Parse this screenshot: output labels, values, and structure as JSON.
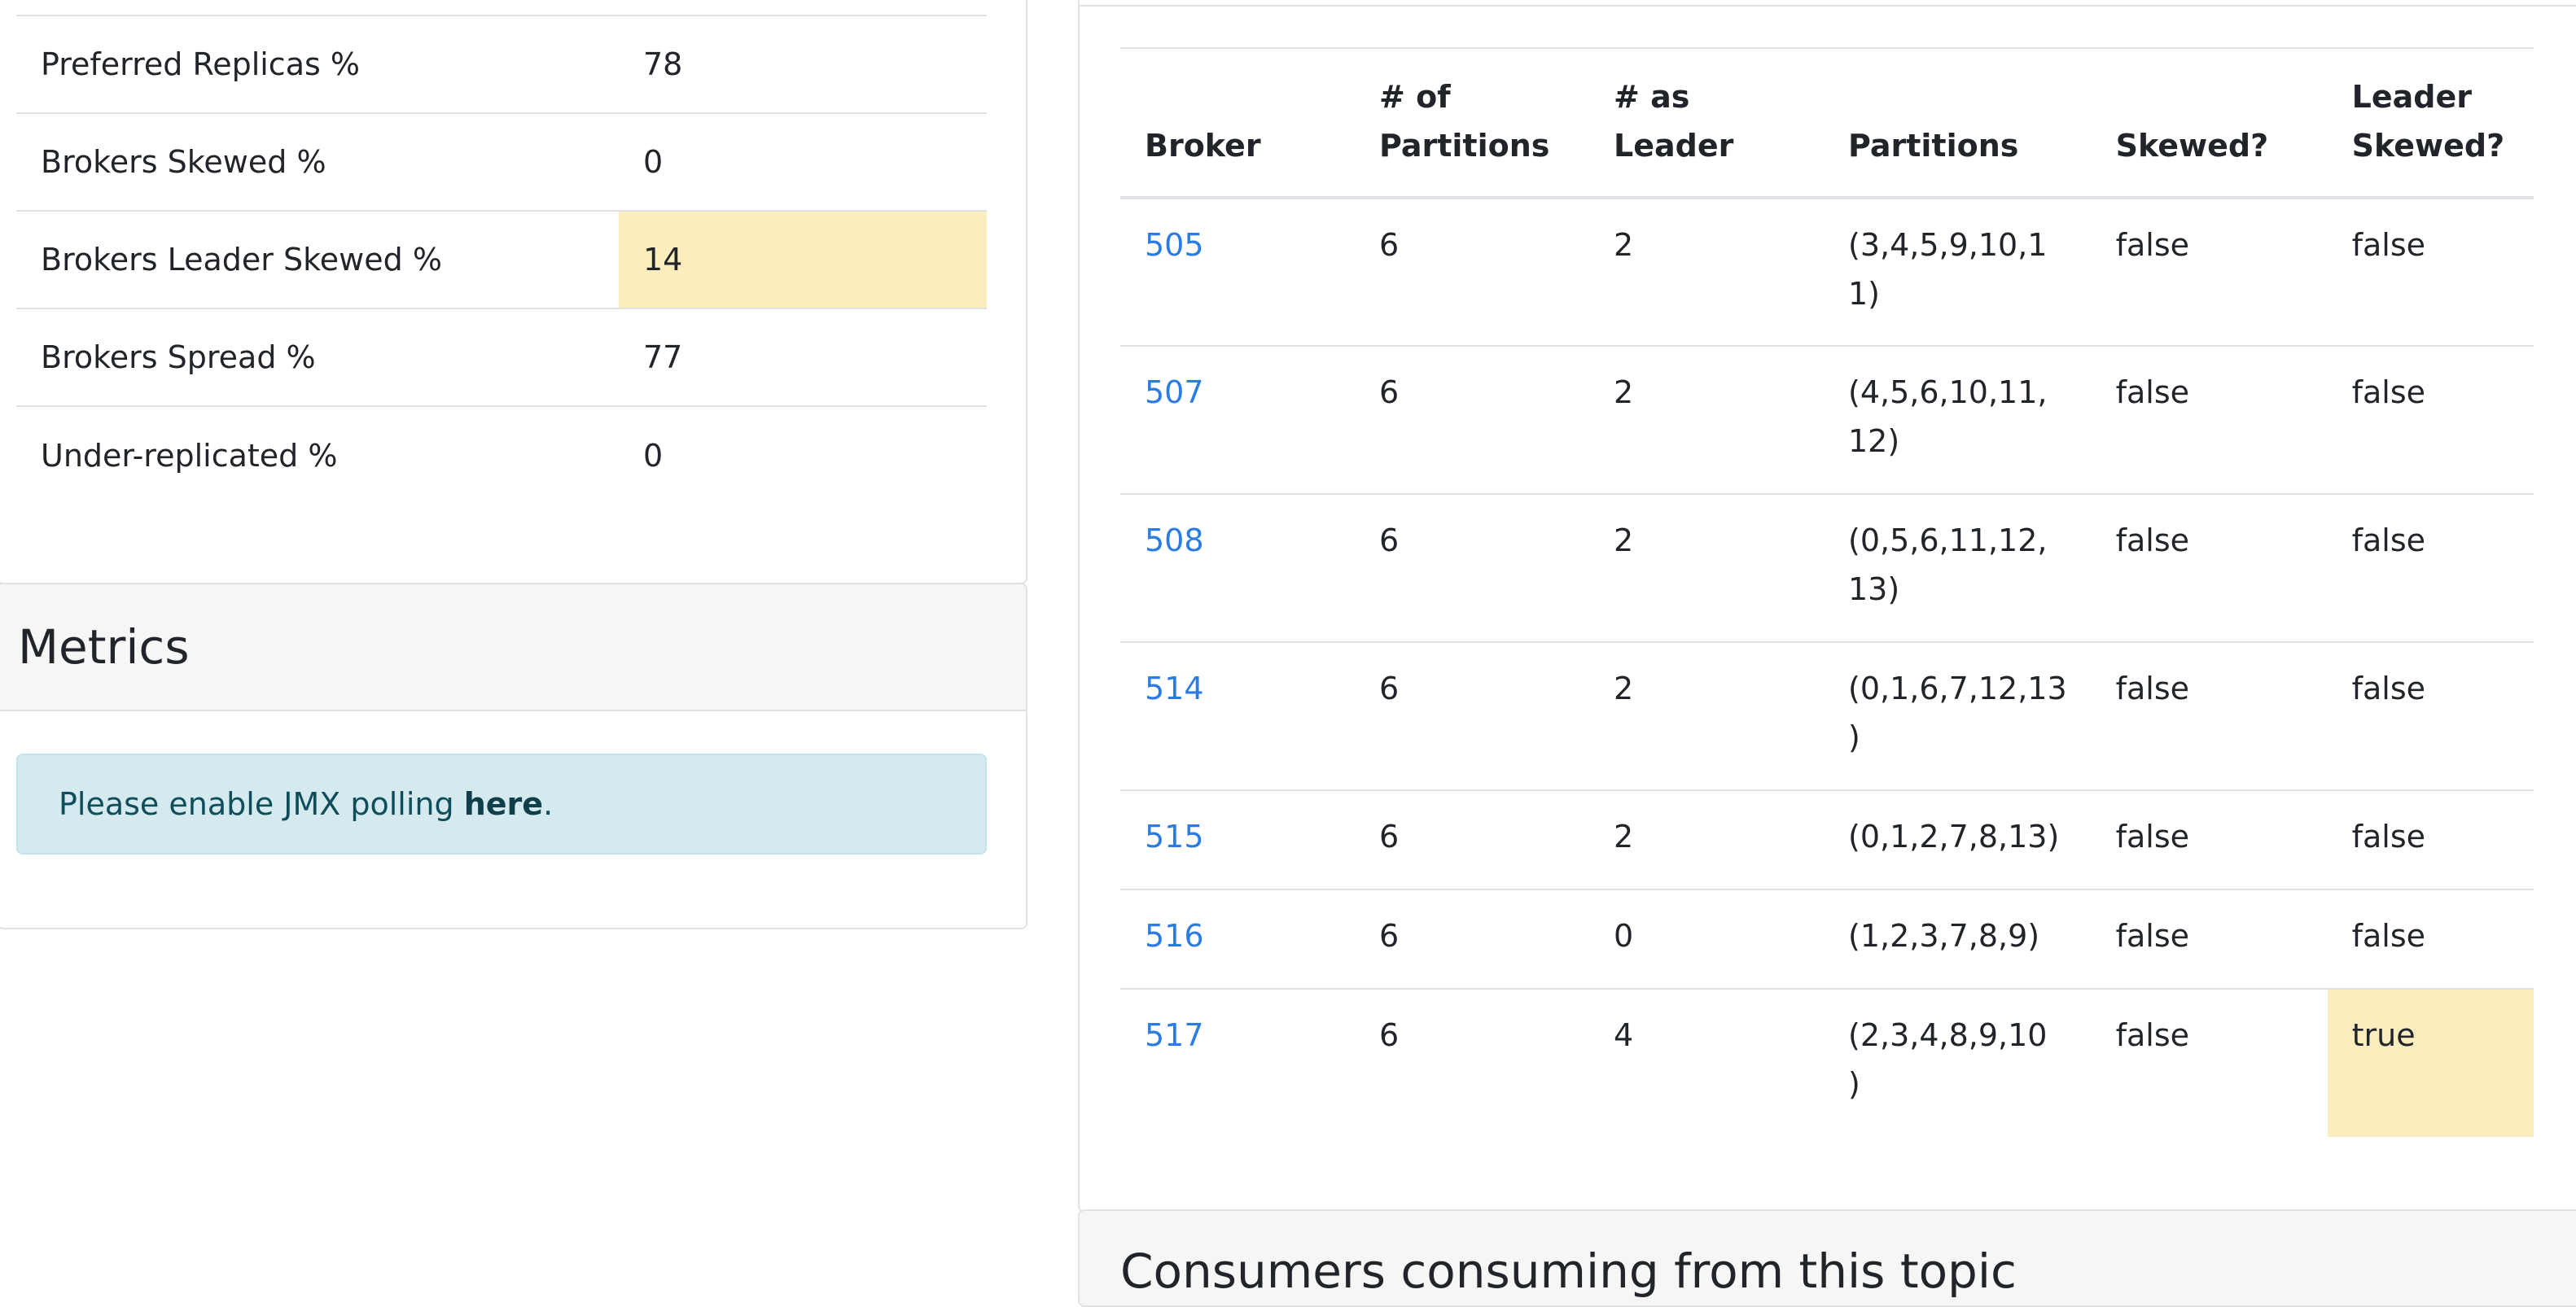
{
  "summary": {
    "rows": [
      {
        "label": "Preferred Replicas %",
        "value": "78",
        "warning": false
      },
      {
        "label": "Brokers Skewed %",
        "value": "0",
        "warning": false
      },
      {
        "label": "Brokers Leader Skewed %",
        "value": "14",
        "warning": true
      },
      {
        "label": "Brokers Spread %",
        "value": "77",
        "warning": false
      },
      {
        "label": "Under-replicated %",
        "value": "0",
        "warning": false
      }
    ]
  },
  "metrics": {
    "title": "Metrics",
    "alert_prefix": "Please enable JMX polling ",
    "alert_link": "here",
    "alert_suffix": "."
  },
  "brokers_table": {
    "headers": {
      "broker": "Broker",
      "partitions_line1": "# of",
      "partitions_line2": "Partitions",
      "as_leader": "# as Leader",
      "partition_list": "Partitions",
      "skewed": "Skewed?",
      "leader_skewed_line1": "Leader",
      "leader_skewed_line2": "Skewed?"
    },
    "rows": [
      {
        "broker": "505",
        "partitions": "6",
        "as_leader": "2",
        "partition_list_l1": "(3,4,5,9,10,1",
        "partition_list_l2": "1)",
        "skewed": "false",
        "leader_skewed": "false"
      },
      {
        "broker": "507",
        "partitions": "6",
        "as_leader": "2",
        "partition_list_l1": "(4,5,6,10,11,",
        "partition_list_l2": "12)",
        "skewed": "false",
        "leader_skewed": "false"
      },
      {
        "broker": "508",
        "partitions": "6",
        "as_leader": "2",
        "partition_list_l1": "(0,5,6,11,12,",
        "partition_list_l2": "13)",
        "skewed": "false",
        "leader_skewed": "false"
      },
      {
        "broker": "514",
        "partitions": "6",
        "as_leader": "2",
        "partition_list_l1": "(0,1,6,7,12,13",
        "partition_list_l2": ")",
        "skewed": "false",
        "leader_skewed": "false"
      },
      {
        "broker": "515",
        "partitions": "6",
        "as_leader": "2",
        "partition_list_l1": "(0,1,2,7,8,13)",
        "partition_list_l2": "",
        "skewed": "false",
        "leader_skewed": "false"
      },
      {
        "broker": "516",
        "partitions": "6",
        "as_leader": "0",
        "partition_list_l1": "(1,2,3,7,8,9)",
        "partition_list_l2": "",
        "skewed": "false",
        "leader_skewed": "false"
      },
      {
        "broker": "517",
        "partitions": "6",
        "as_leader": "4",
        "partition_list_l1": "(2,3,4,8,9,10",
        "partition_list_l2": ")",
        "skewed": "false",
        "leader_skewed": "true"
      }
    ]
  },
  "next_section": {
    "title_partial": "Consumers consuming from this topic"
  },
  "colors": {
    "link": "#2b7be4",
    "warning_bg": "#fcedbe",
    "info_bg": "#d5eaef",
    "header_bg": "#f6f6f6"
  }
}
